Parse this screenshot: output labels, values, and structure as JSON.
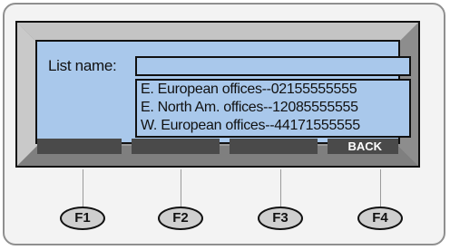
{
  "list_name_label": "List name:",
  "list_items": [
    "E. European offices--02155555555",
    "E. North Am. offices--12085555555",
    "W. European offices--44171555555"
  ],
  "softkeys": [
    "",
    "",
    "",
    "BACK"
  ],
  "function_buttons": [
    "F1",
    "F2",
    "F3",
    "F4"
  ],
  "colors": {
    "screen": "#a9c8eb",
    "softkey_bar": "#4a4a4a",
    "bezel": "#9a9a9a"
  }
}
